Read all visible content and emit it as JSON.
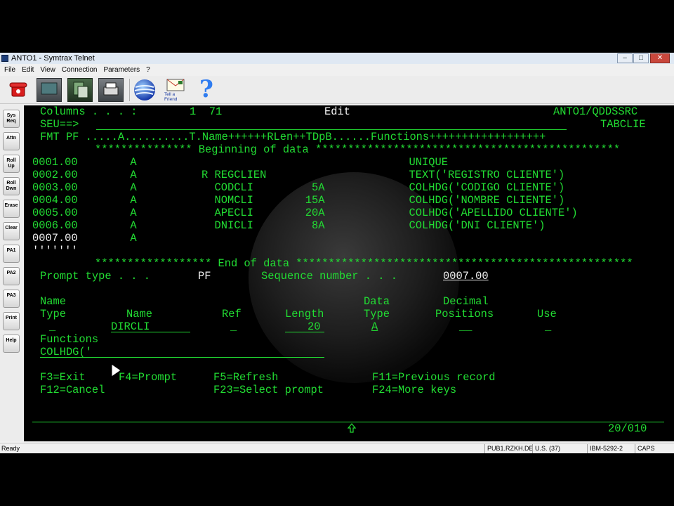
{
  "window": {
    "title": "ANTO1 - Symtrax Telnet"
  },
  "menu": [
    "File",
    "Edit",
    "View",
    "Connection",
    "Parameters",
    "?"
  ],
  "toolbar": {
    "tell_friend": "Tell a Friend",
    "help_glyph": "?"
  },
  "side_buttons": [
    {
      "label": "Sys Req"
    },
    {
      "label": "Attn"
    },
    {
      "label": "Roll Up"
    },
    {
      "label": "Roll Dwn"
    },
    {
      "label": "Erase"
    },
    {
      "label": "Clear"
    },
    {
      "label": "PA1"
    },
    {
      "label": "PA2"
    },
    {
      "label": "PA3"
    },
    {
      "label": "Print"
    },
    {
      "label": "Help"
    }
  ],
  "terminal": {
    "header_columns_label": "Columns . . . :",
    "header_columns_value": "1  71",
    "header_mode": "Edit",
    "header_file": "ANTO1/QDDSSRC",
    "seu_prompt": "SEU==>",
    "member": "TABCLIE",
    "ruler": "FMT PF .....A..........T.Name++++++RLen++TDpB......Functions++++++++++++++++++",
    "beginning_of_data": "*************** Beginning of data ***********************************************",
    "lines": [
      {
        "seq": "0001.00",
        "text": "      A                                          UNIQUE"
      },
      {
        "seq": "0002.00",
        "text": "      A          R REGCLIEN                      TEXT('REGISTRO CLIENTE')"
      },
      {
        "seq": "0003.00",
        "text": "      A            CODCLI         5A             COLHDG('CODIGO CLIENTE')"
      },
      {
        "seq": "0004.00",
        "text": "      A            NOMCLI        15A             COLHDG('NOMBRE CLIENTE')"
      },
      {
        "seq": "0005.00",
        "text": "      A            APECLI        20A             COLHDG('APELLIDO CLIENTE')"
      },
      {
        "seq": "0006.00",
        "text": "      A            DNICLI         8A             COLHDG('DNI CLIENTE')"
      }
    ],
    "current_line": {
      "seq": "0007.00",
      "text": "      A"
    },
    "blank_marker": "'''''''",
    "end_of_data": "****************** End of data ****************************************************",
    "prompt_type_label": "Prompt type . . .",
    "prompt_type_value": "PF",
    "sequence_label": "Sequence number . . .",
    "sequence_value": "0007.00",
    "col_headers": {
      "name": "Name",
      "type": "Type",
      "name2": "Name",
      "ref": "Ref",
      "length": "Length",
      "data": "Data",
      "data_type": "Type",
      "decimal": "Decimal",
      "positions": "Positions",
      "use": "Use"
    },
    "fields": {
      "type_value": "_",
      "name_value": "DIRCLI",
      "ref_value": "_",
      "length_value": "20",
      "data_type_value": "A",
      "positions_value": "__",
      "use_value": "_"
    },
    "functions_label": "Functions",
    "functions_value": "COLHDG('",
    "fkeys_row1": [
      "F3=Exit",
      "F4=Prompt",
      "F5=Refresh",
      "F11=Previous record"
    ],
    "fkeys_row2": [
      "F12=Cancel",
      "F23=Select prompt",
      "F24=More keys"
    ],
    "cursor_pos": "20/010"
  },
  "status": {
    "text": "Ready",
    "host": "PUB1.RZKH.DE",
    "codepage": "U.S. (37)",
    "terminal": "IBM-5292-2",
    "caps": "CAPS"
  }
}
